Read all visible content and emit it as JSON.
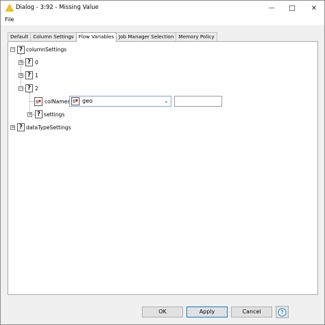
{
  "window": {
    "title": "Dialog - 3:92 - Missing Value",
    "minimize_glyph": "—",
    "maximize_glyph": "☐",
    "close_glyph": "✕"
  },
  "menu": {
    "file": "File"
  },
  "tabs": [
    {
      "label": "Default",
      "active": false
    },
    {
      "label": "Column Settings",
      "active": false
    },
    {
      "label": "Flow Variables",
      "active": true
    },
    {
      "label": "Job Manager Selection",
      "active": false
    },
    {
      "label": "Memory Policy",
      "active": false
    }
  ],
  "tree": {
    "root_label": "columnSettings",
    "child_0": "0",
    "child_1": "1",
    "child_2": "2",
    "colnames_label": "colNames",
    "settings_label": "settings",
    "datatype_label": "dataTypeSettings",
    "q_glyph": "?",
    "var_glyph": "s",
    "plus_glyph": "+",
    "minus_glyph": "−"
  },
  "colnames_combo": {
    "value": "geo",
    "arrow": "⌄"
  },
  "colnames_text": {
    "value": ""
  },
  "buttons": {
    "ok": "OK",
    "apply": "Apply",
    "cancel": "Cancel",
    "help": "?"
  },
  "colors": {
    "accent": "#0078d7",
    "warning": "#f2c200",
    "var_red": "#d33333"
  }
}
